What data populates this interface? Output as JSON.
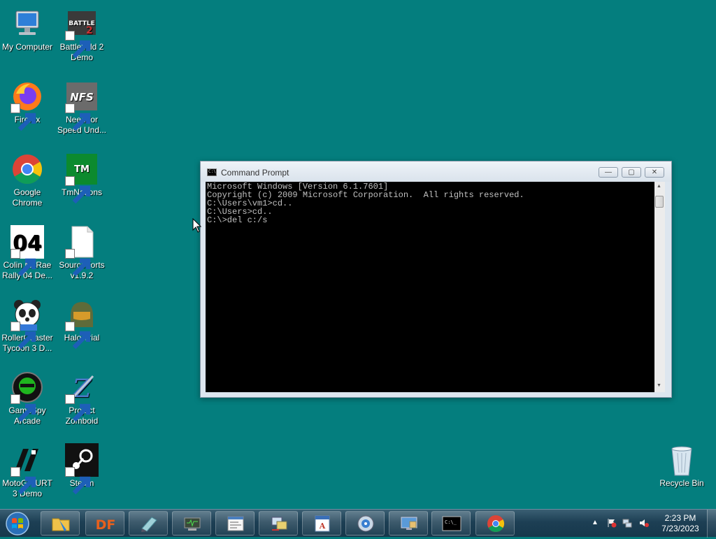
{
  "desktop": {
    "icons": [
      {
        "label": "My Computer"
      },
      {
        "label": "Battlefield 2 Demo"
      },
      {
        "label": "Firefox"
      },
      {
        "label": "Need for Speed Und..."
      },
      {
        "label": "Google Chrome"
      },
      {
        "label": "TmNations"
      },
      {
        "label": "Colin McRae Rally 04 De..."
      },
      {
        "label": "SourceForts v1.9.2"
      },
      {
        "label": "RollerCoaster Tycoon 3 D..."
      },
      {
        "label": "Halo Trial"
      },
      {
        "label": "GameSpy Arcade"
      },
      {
        "label": "Project Zomboid"
      },
      {
        "label": "MotoGP URT 3 Demo"
      },
      {
        "label": "Steam"
      },
      {
        "label": "Recycle Bin"
      }
    ]
  },
  "cmd": {
    "title": "Command Prompt",
    "icon_text": "C:\\",
    "lines": [
      "Microsoft Windows [Version 6.1.7601]",
      "Copyright (c) 2009 Microsoft Corporation.  All rights reserved.",
      "",
      "C:\\Users\\vm1>cd..",
      "",
      "C:\\Users>cd..",
      "",
      "C:\\>del c:/s"
    ],
    "buttons": {
      "minimize": "—",
      "maximize": "▢",
      "close": "✕"
    }
  },
  "taskbar": {
    "items": [
      {
        "icon": "explorer-folder-icon"
      },
      {
        "icon": "df-app-icon",
        "text": "DF"
      },
      {
        "icon": "notepad-pen-icon"
      },
      {
        "icon": "device-manager-icon"
      },
      {
        "icon": "document-window-icon"
      },
      {
        "icon": "network-setup-icon"
      },
      {
        "icon": "wordpad-icon"
      },
      {
        "icon": "dvd-disc-icon"
      },
      {
        "icon": "remote-desktop-icon"
      },
      {
        "icon": "command-prompt-icon",
        "text": "C:\\_"
      },
      {
        "icon": "chrome-icon"
      }
    ],
    "tray": {
      "time": "2:23 PM",
      "date": "7/23/2023"
    }
  }
}
